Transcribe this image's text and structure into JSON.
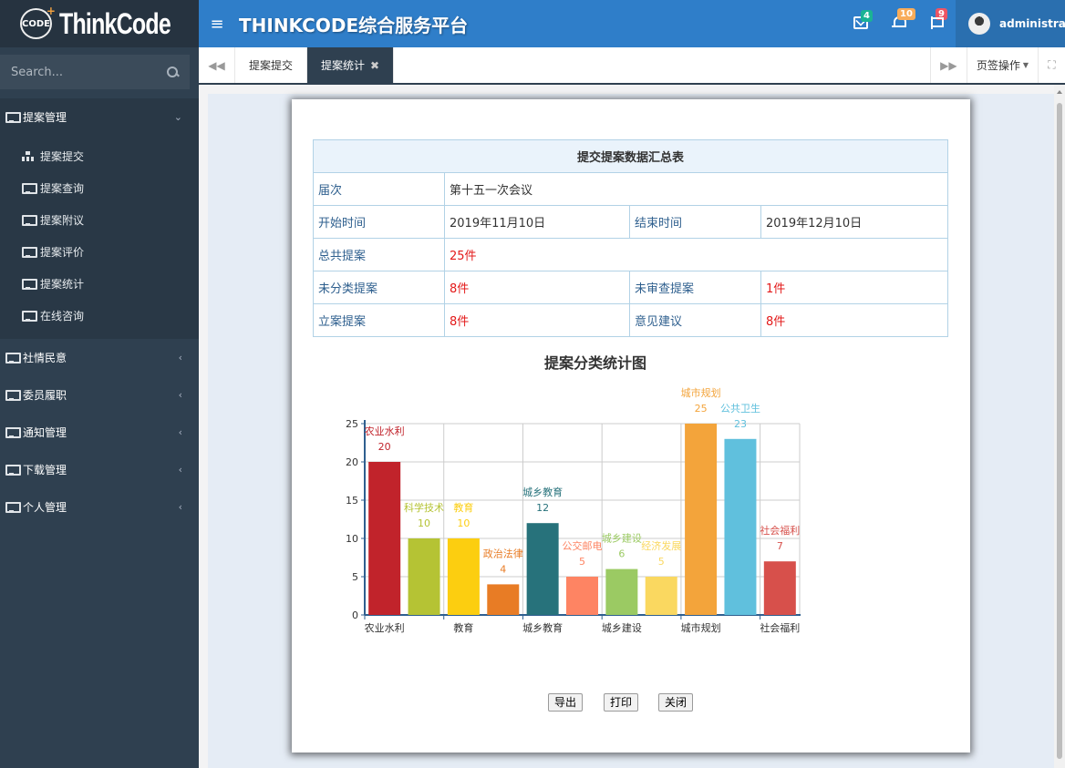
{
  "app": {
    "logo_text": "ThinkCode",
    "logo_badge": "CODE",
    "title": "THINKCODE综合服务平台"
  },
  "search": {
    "placeholder": "Search..."
  },
  "header": {
    "notifications": [
      {
        "icon": "envelope-icon",
        "count": "4",
        "color": "#1ab394"
      },
      {
        "icon": "bell-icon",
        "count": "10",
        "color": "#f8ac59"
      },
      {
        "icon": "flag-icon",
        "count": "9",
        "color": "#ed5565"
      }
    ],
    "username": "administrator"
  },
  "sidebar": {
    "menu": [
      {
        "label": "提案管理",
        "expanded": true,
        "children": [
          {
            "label": "提案提交",
            "icon": "sitemap-icon"
          },
          {
            "label": "提案查询",
            "icon": "monitor-icon"
          },
          {
            "label": "提案附议",
            "icon": "monitor-icon"
          },
          {
            "label": "提案评价",
            "icon": "monitor-icon"
          },
          {
            "label": "提案统计",
            "icon": "monitor-icon"
          },
          {
            "label": "在线咨询",
            "icon": "monitor-icon"
          }
        ]
      },
      {
        "label": "社情民意",
        "expanded": false
      },
      {
        "label": "委员履职",
        "expanded": false
      },
      {
        "label": "通知管理",
        "expanded": false
      },
      {
        "label": "下载管理",
        "expanded": false
      },
      {
        "label": "个人管理",
        "expanded": false
      }
    ]
  },
  "tabs": {
    "items": [
      {
        "label": "提案提交",
        "active": false
      },
      {
        "label": "提案统计",
        "active": true
      }
    ],
    "page_ops": "页签操作"
  },
  "summary": {
    "title": "提交提案数据汇总表",
    "session_label": "届次",
    "session_value": "第十五一次会议",
    "start_label": "开始时间",
    "start_value": "2019年11月10日",
    "end_label": "结束时间",
    "end_value": "2019年12月10日",
    "total_label": "总共提案",
    "total_value": "25件",
    "unclassified_label": "未分类提案",
    "unclassified_value": "8件",
    "unreviewed_label": "未审查提案",
    "unreviewed_value": "1件",
    "filed_label": "立案提案",
    "filed_value": "8件",
    "opinion_label": "意见建议",
    "opinion_value": "8件"
  },
  "chart_data": {
    "type": "bar",
    "title": "提案分类统计图",
    "categories": [
      "农业水利",
      "科学技术",
      "教育",
      "政治法律",
      "城乡教育",
      "公交邮电",
      "城乡建设",
      "经济发展",
      "城市规划",
      "公共卫生",
      "社会福利"
    ],
    "values": [
      20,
      10,
      10,
      4,
      12,
      5,
      6,
      5,
      25,
      23,
      7
    ],
    "colors": [
      "#c1232b",
      "#b5c334",
      "#fcce10",
      "#e87c25",
      "#27727b",
      "#fe8463",
      "#9bca63",
      "#fad860",
      "#f3a43b",
      "#60c0dd",
      "#d7504b"
    ],
    "x_tick_labels": [
      "农业水利",
      "教育",
      "城乡教育",
      "城乡建设",
      "城市规划",
      "社会福利"
    ],
    "y_ticks": [
      0,
      5,
      10,
      15,
      20,
      25
    ],
    "ylim": [
      0,
      25
    ],
    "grid": true
  },
  "buttons": {
    "export": "导出",
    "print": "打印",
    "close": "关闭"
  }
}
